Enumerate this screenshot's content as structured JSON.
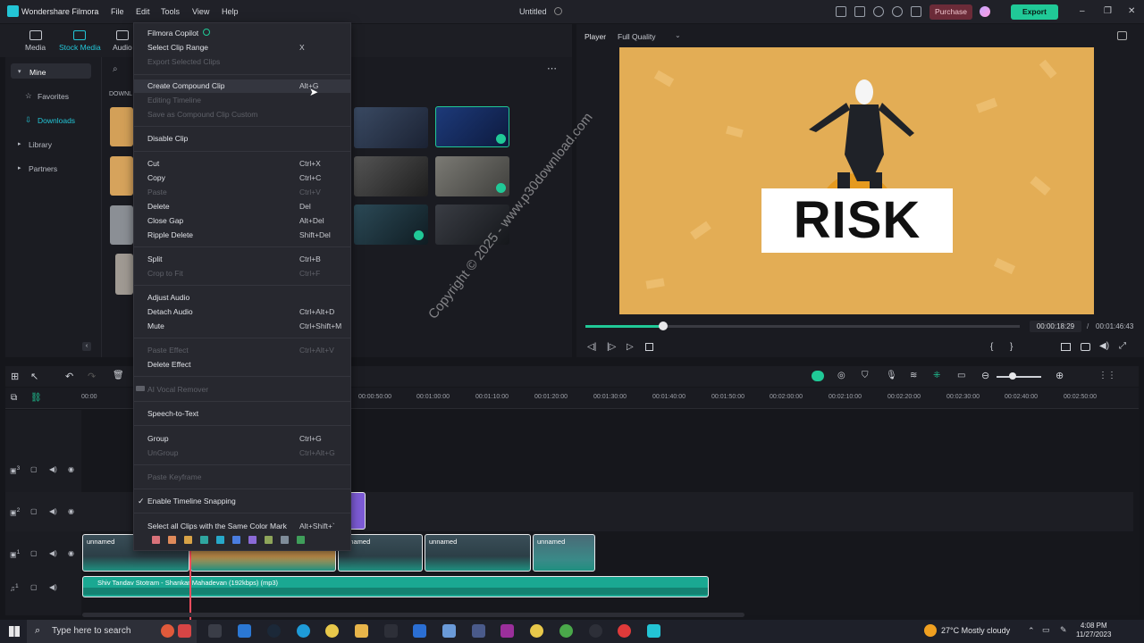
{
  "titlebar": {
    "app_name": "Wondershare Filmora",
    "menus": [
      "File",
      "Edit",
      "Tools",
      "View",
      "Help"
    ],
    "doc_title": "Untitled",
    "purchase_label": "Purchase",
    "export_label": "Export",
    "win_controls": [
      "–",
      "❐",
      "✕"
    ]
  },
  "media_tabs": [
    "Media",
    "Stock Media",
    "Audio"
  ],
  "sidebar": {
    "items": [
      {
        "label": "Mine"
      },
      {
        "label": "Favorites"
      },
      {
        "label": "Downloads"
      },
      {
        "label": "Library"
      },
      {
        "label": "Partners"
      }
    ],
    "section_label": "DOWNL"
  },
  "context_menu": {
    "items": [
      {
        "label": "Filmora Copilot",
        "shortcut": "",
        "disabled": false
      },
      {
        "label": "Select Clip Range",
        "shortcut": "X",
        "disabled": false
      },
      {
        "label": "Export Selected Clips",
        "shortcut": "",
        "disabled": true
      },
      {
        "label": "Create Compound Clip",
        "shortcut": "Alt+G",
        "disabled": false
      },
      {
        "label": "Editing Timeline",
        "shortcut": "",
        "disabled": true
      },
      {
        "label": "Save as Compound Clip Custom",
        "shortcut": "",
        "disabled": true
      },
      {
        "label": "Disable Clip",
        "shortcut": "",
        "disabled": false
      },
      {
        "label": "Cut",
        "shortcut": "Ctrl+X",
        "disabled": false
      },
      {
        "label": "Copy",
        "shortcut": "Ctrl+C",
        "disabled": false
      },
      {
        "label": "Paste",
        "shortcut": "Ctrl+V",
        "disabled": true
      },
      {
        "label": "Delete",
        "shortcut": "Del",
        "disabled": false
      },
      {
        "label": "Close Gap",
        "shortcut": "Alt+Del",
        "disabled": false
      },
      {
        "label": "Ripple Delete",
        "shortcut": "Shift+Del",
        "disabled": false
      },
      {
        "label": "Split",
        "shortcut": "Ctrl+B",
        "disabled": false
      },
      {
        "label": "Crop to Fit",
        "shortcut": "Ctrl+F",
        "disabled": true
      },
      {
        "label": "Adjust Audio",
        "shortcut": "",
        "disabled": false
      },
      {
        "label": "Detach Audio",
        "shortcut": "Ctrl+Alt+D",
        "disabled": false
      },
      {
        "label": "Mute",
        "shortcut": "Ctrl+Shift+M",
        "disabled": false
      },
      {
        "label": "Paste Effect",
        "shortcut": "Ctrl+Alt+V",
        "disabled": true
      },
      {
        "label": "Delete Effect",
        "shortcut": "",
        "disabled": false
      },
      {
        "label": "AI Vocal Remover",
        "shortcut": "",
        "disabled": true
      },
      {
        "label": "Speech-to-Text",
        "shortcut": "",
        "disabled": false
      },
      {
        "label": "Group",
        "shortcut": "Ctrl+G",
        "disabled": false
      },
      {
        "label": "UnGroup",
        "shortcut": "Ctrl+Alt+G",
        "disabled": true
      },
      {
        "label": "Paste Keyframe",
        "shortcut": "",
        "disabled": true
      },
      {
        "label": "Enable Timeline Snapping",
        "shortcut": "",
        "disabled": false,
        "checked": true
      },
      {
        "label": "Select all Clips with the Same Color Mark",
        "shortcut": "Alt+Shift+`",
        "disabled": false
      }
    ],
    "color_marks": [
      "#d9727a",
      "#e08a5a",
      "#d8a347",
      "#2fa6a0",
      "#27a8c9",
      "#4a7de0",
      "#8b6ad6",
      "#8ea55a",
      "#7f8c99",
      "#3f9e5a"
    ]
  },
  "player": {
    "label": "Player",
    "quality": "Full Quality",
    "preview_text": "RISK",
    "current_time": "00:00:18:29",
    "total_time": "00:01:46:43",
    "progress_fraction": 0.177
  },
  "timeline": {
    "ruler_times": [
      "00:00",
      "00:00:50:00",
      "00:01:00:00",
      "00:01:10:00",
      "00:01:20:00",
      "00:01:30:00",
      "00:01:40:00",
      "00:01:50:00",
      "00:02:00:00",
      "00:02:10:00",
      "00:02:20:00",
      "00:02:30:00",
      "00:02:40:00",
      "00:02:50:00"
    ],
    "clips": [
      {
        "label": "unnamed"
      },
      {
        "label": "unnamed"
      },
      {
        "label": "unnamed"
      },
      {
        "label": "unnamed"
      },
      {
        "label": "unnamed"
      }
    ],
    "audio_clip_label": "Shiv Tandav Stotram - Shankar Mahadevan (192kbps) (mp3)",
    "track_numbers": [
      "3",
      "2",
      "1",
      "1"
    ]
  },
  "taskbar": {
    "search_placeholder": "Type here to search",
    "weather": "27°C  Mostly cloudy",
    "time": "4:08 PM",
    "date": "11/27/2023"
  },
  "watermark": "Copyright © 2025 - www.p30download.com",
  "colors": {
    "accent": "#20c997",
    "playhead": "#ff4d5e",
    "purchase": "#6b2b38",
    "preview_bg": "#e3ad55"
  }
}
